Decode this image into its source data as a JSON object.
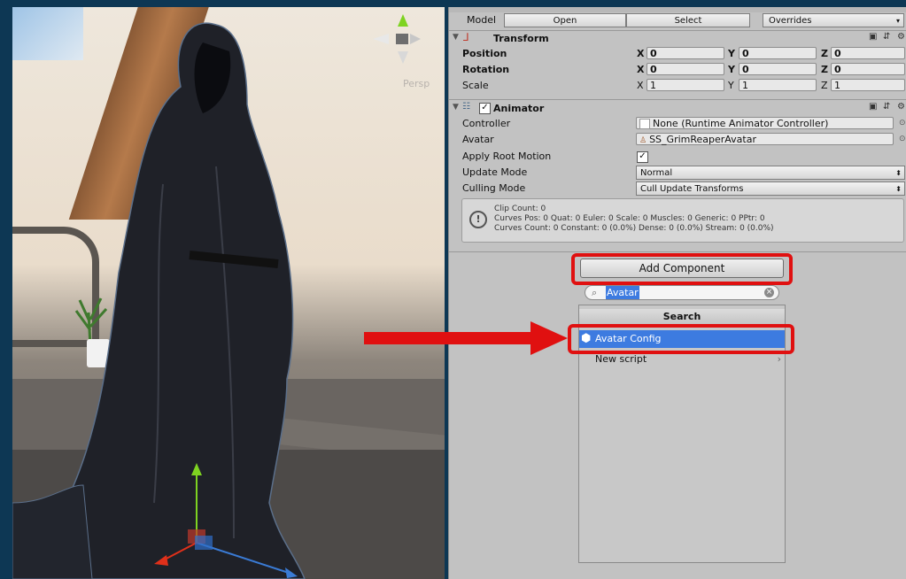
{
  "scene": {
    "persp_label": "Persp"
  },
  "inspector": {
    "model": {
      "label": "Model",
      "open": "Open",
      "select": "Select",
      "overrides": "Overrides"
    },
    "transform": {
      "title": "Transform",
      "position": {
        "label": "Position",
        "x": "0",
        "y": "0",
        "z": "0"
      },
      "rotation": {
        "label": "Rotation",
        "x": "0",
        "y": "0",
        "z": "0"
      },
      "scale": {
        "label": "Scale",
        "x": "1",
        "y": "1",
        "z": "1"
      }
    },
    "animator": {
      "title": "Animator",
      "controller_label": "Controller",
      "controller_value": "None (Runtime Animator Controller)",
      "avatar_label": "Avatar",
      "avatar_value": "SS_GrimReaperAvatar",
      "apply_root_label": "Apply Root Motion",
      "apply_root_checked": true,
      "update_mode_label": "Update Mode",
      "update_mode_value": "Normal",
      "culling_mode_label": "Culling Mode",
      "culling_mode_value": "Cull Update Transforms",
      "info": {
        "line1": "Clip Count: 0",
        "line2": "Curves Pos: 0 Quat: 0 Euler: 0 Scale: 0 Muscles: 0 Generic: 0 PPtr: 0",
        "line3": "Curves Count: 0 Constant: 0 (0.0%) Dense: 0 (0.0%) Stream: 0 (0.0%)"
      }
    },
    "add_component": {
      "button": "Add Component",
      "search_value": "Avatar",
      "header": "Search",
      "result": "Avatar Config",
      "new_script": "New script"
    }
  },
  "colors": {
    "highlight": "#e01010",
    "selection": "#3d7be0"
  }
}
